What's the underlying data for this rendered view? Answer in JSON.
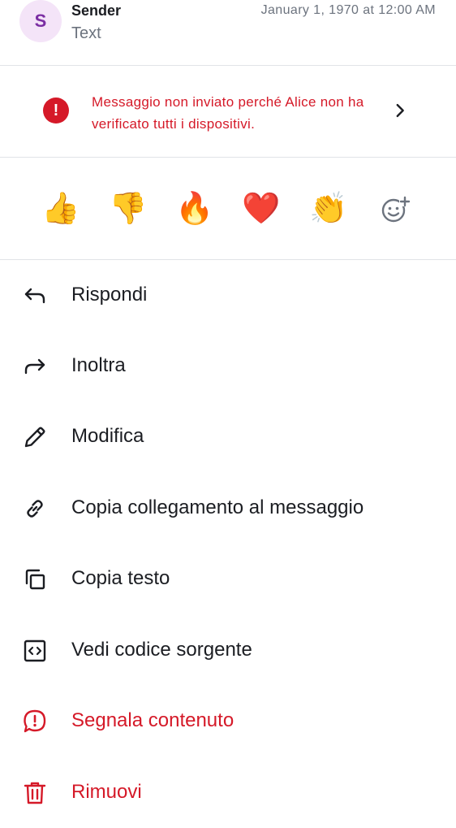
{
  "message": {
    "avatar_letter": "S",
    "sender": "Sender",
    "text": "Text",
    "timestamp": "January 1, 1970 at 12:00 AM"
  },
  "warning": {
    "icon": "!",
    "text": "Messaggio non inviato perché Alice non ha verificato tutti i dispositivi."
  },
  "reactions": {
    "items": [
      "👍",
      "👎",
      "🔥",
      "❤️",
      "👏"
    ],
    "add_icon": "add-reaction-icon"
  },
  "menu": {
    "items": [
      {
        "label": "Rispondi",
        "icon": "reply-icon"
      },
      {
        "label": "Inoltra",
        "icon": "forward-icon"
      },
      {
        "label": "Modifica",
        "icon": "edit-icon"
      },
      {
        "label": "Copia collegamento al messaggio",
        "icon": "link-icon"
      },
      {
        "label": "Copia testo",
        "icon": "copy-icon"
      },
      {
        "label": "Vedi codice sorgente",
        "icon": "code-icon"
      },
      {
        "label": "Segnala contenuto",
        "icon": "report-icon"
      },
      {
        "label": "Rimuovi",
        "icon": "delete-icon"
      }
    ]
  },
  "colors": {
    "text": "#1b1d22",
    "secondary": "#6c737e",
    "danger": "#d51928",
    "avatar_bg": "#f4e4f8",
    "avatar_fg": "#7b2ea3",
    "divider": "#e1e3e7"
  }
}
